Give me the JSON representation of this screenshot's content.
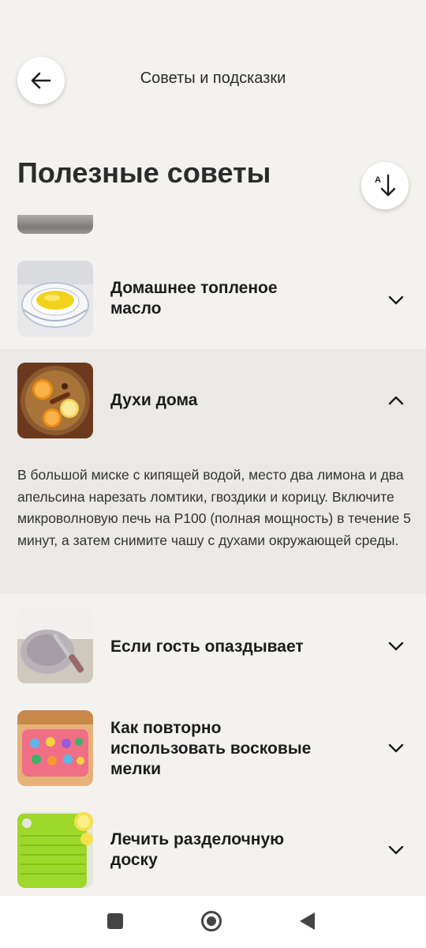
{
  "header": {
    "title": "Советы и подсказки",
    "back_icon": "arrow-left-icon"
  },
  "page": {
    "title": "Полезные советы",
    "sort_icon": "sort-alpha-down-icon",
    "sort_icon_letter": "A"
  },
  "tips": [
    {
      "title": "Домашнее топленое масло",
      "expanded": false,
      "image": "ghee-bowl"
    },
    {
      "title": "Духи дома",
      "expanded": true,
      "image": "citrus-bowl",
      "description": "В большой миске с кипящей водой, место два лимона и два апельсина нарезать ломтики, гвоздики и корицу. Включите микроволновую печь на P100 (полная мощность) в течение 5 минут, а затем снимите чашу с духами окружающей среды."
    },
    {
      "title": "Если гость опаздывает",
      "expanded": false,
      "image": "plate-cutlery"
    },
    {
      "title": "Как повторно использовать восковые мелки",
      "expanded": false,
      "image": "crayon-mold"
    },
    {
      "title": "Лечить разделочную доску",
      "expanded": false,
      "image": "green-cutting-board"
    }
  ],
  "navbar": {
    "recents_icon": "square-icon",
    "home_icon": "home-circle-icon",
    "back_icon": "triangle-back-icon"
  },
  "colors": {
    "background": "#f4f2ef",
    "expanded_row": "#ebe9e6",
    "text": "#1c1c1c"
  }
}
